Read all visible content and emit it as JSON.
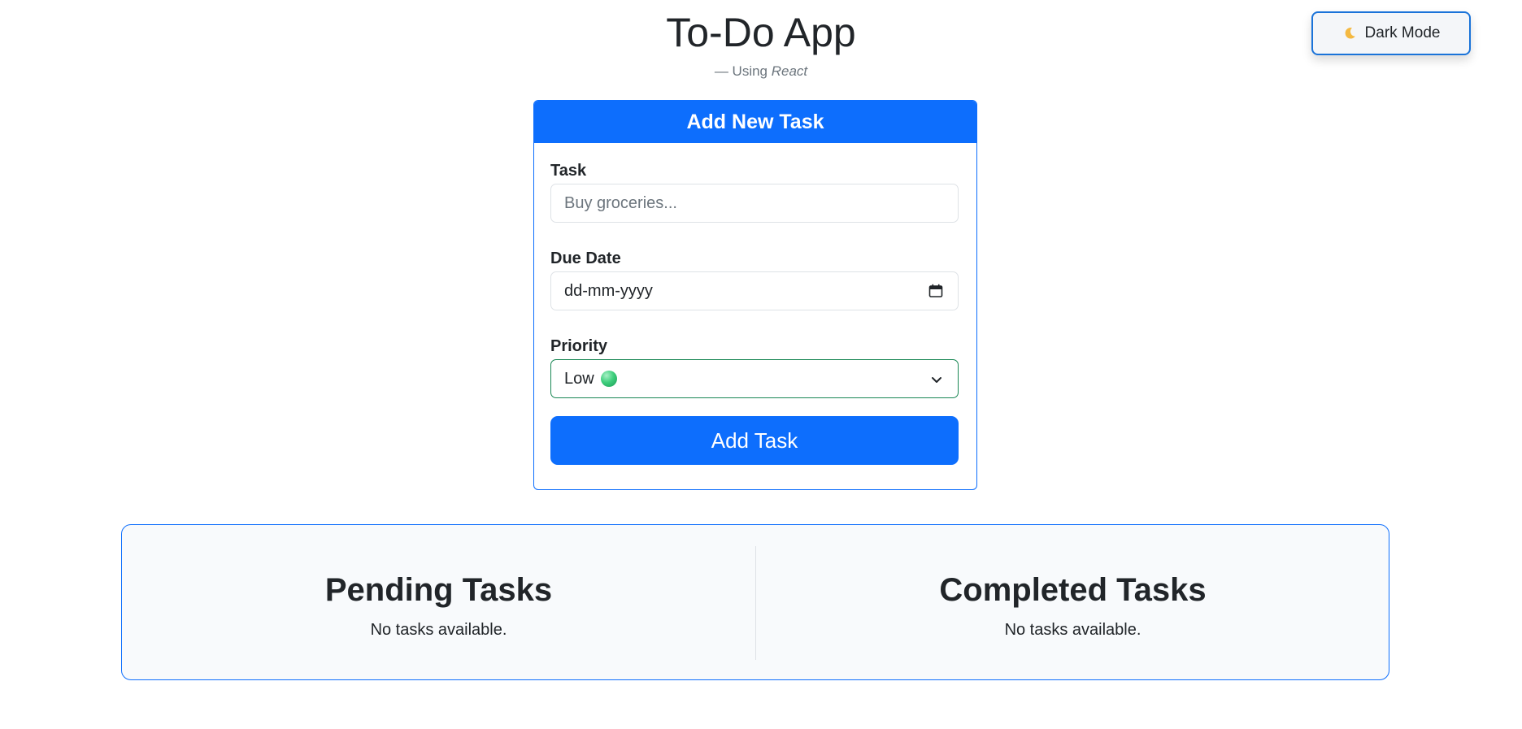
{
  "header": {
    "title": "To-Do App",
    "subtitle_prefix": "— Using ",
    "subtitle_tech": "React"
  },
  "theme_toggle": {
    "label": "Dark Mode",
    "icon": "moon-icon"
  },
  "form": {
    "heading": "Add New Task",
    "task": {
      "label": "Task",
      "placeholder": "Buy groceries...",
      "value": ""
    },
    "due_date": {
      "label": "Due Date",
      "placeholder": "dd-mm-yyyy",
      "icon": "calendar-icon"
    },
    "priority": {
      "label": "Priority",
      "selected": "Low",
      "indicator_color": "#3fcf7d",
      "icon": "chevron-down-icon"
    },
    "submit_label": "Add Task"
  },
  "tasks": {
    "pending": {
      "title": "Pending Tasks",
      "empty_text": "No tasks available."
    },
    "completed": {
      "title": "Completed Tasks",
      "empty_text": "No tasks available."
    }
  },
  "colors": {
    "primary": "#0d6efd",
    "success_border": "#198754",
    "panel_bg": "#f8fafc"
  }
}
